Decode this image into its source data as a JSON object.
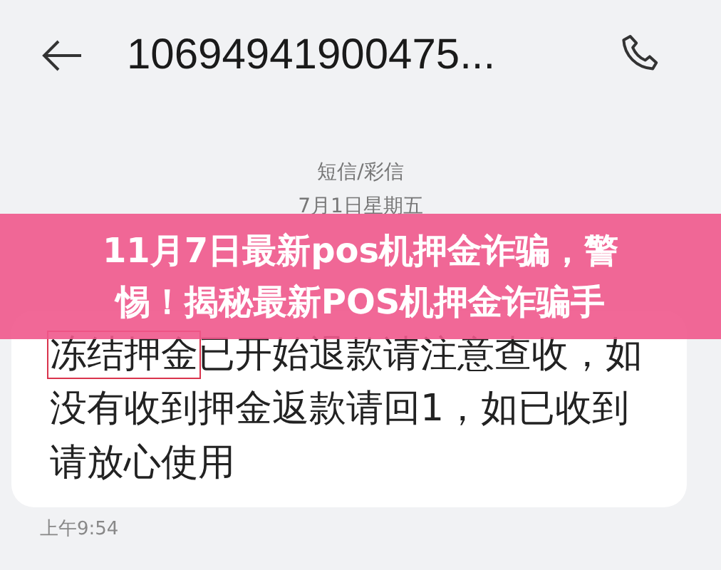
{
  "header": {
    "title": "10694941900475..."
  },
  "channel_label": "短信/彩信",
  "date": "7月1日星期五",
  "banner": {
    "title_lines": [
      "11月7日最新pos机押金诈骗，警",
      "惕！揭秘最新POS机押金诈骗手"
    ]
  },
  "message": {
    "highlight": "冻结押金",
    "text": "已开始退款请注意查收，如没有收到押金返款请回1，如已收到请放心使用",
    "time": "上午9:54"
  }
}
